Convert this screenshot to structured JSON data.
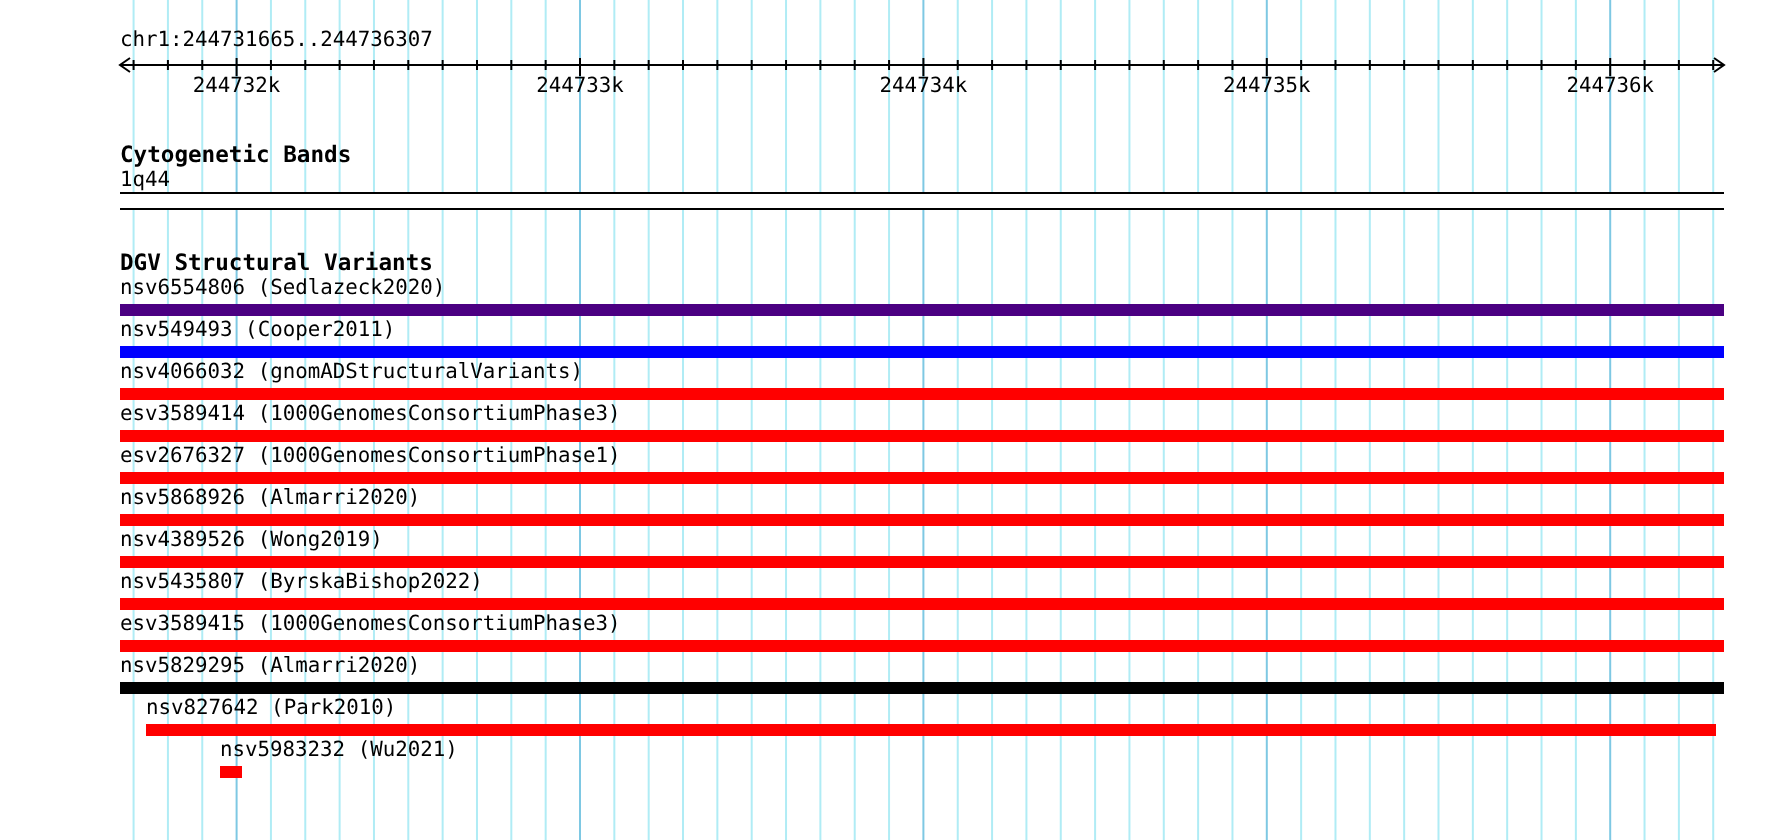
{
  "ruler": {
    "region": "chr1:244731665..244736307",
    "tick_labels": [
      "244732k",
      "244733k",
      "244734k",
      "244735k",
      "244736k"
    ]
  },
  "tracks": [
    {
      "title": "Cytogenetic Bands",
      "kind": "bands",
      "band": "1q44"
    },
    {
      "title": "DGV Structural Variants",
      "kind": "variants",
      "features": [
        {
          "label": "nsv6554806 (Sedlazeck2020)",
          "color": "#4b0082"
        },
        {
          "label": "nsv549493 (Cooper2011)",
          "color": "#0000ff"
        },
        {
          "label": "nsv4066032 (gnomADStructuralVariants)",
          "color": "#ff0000"
        },
        {
          "label": "esv3589414 (1000GenomesConsortiumPhase3)",
          "color": "#ff0000"
        },
        {
          "label": "esv2676327 (1000GenomesConsortiumPhase1)",
          "color": "#ff0000"
        },
        {
          "label": "nsv5868926 (Almarri2020)",
          "color": "#ff0000"
        },
        {
          "label": "nsv4389526 (Wong2019)",
          "color": "#ff0000"
        },
        {
          "label": "nsv5435807 (ByrskaBishop2022)",
          "color": "#ff0000"
        },
        {
          "label": "esv3589415 (1000GenomesConsortiumPhase3)",
          "color": "#ff0000"
        },
        {
          "label": "nsv5829295 (Almarri2020)",
          "color": "#000000"
        },
        {
          "label": "nsv827642 (Park2010)",
          "color": "#ff0000"
        },
        {
          "label": "nsv5983232 (Wu2021)",
          "color": "#ff0000"
        }
      ]
    }
  ]
}
